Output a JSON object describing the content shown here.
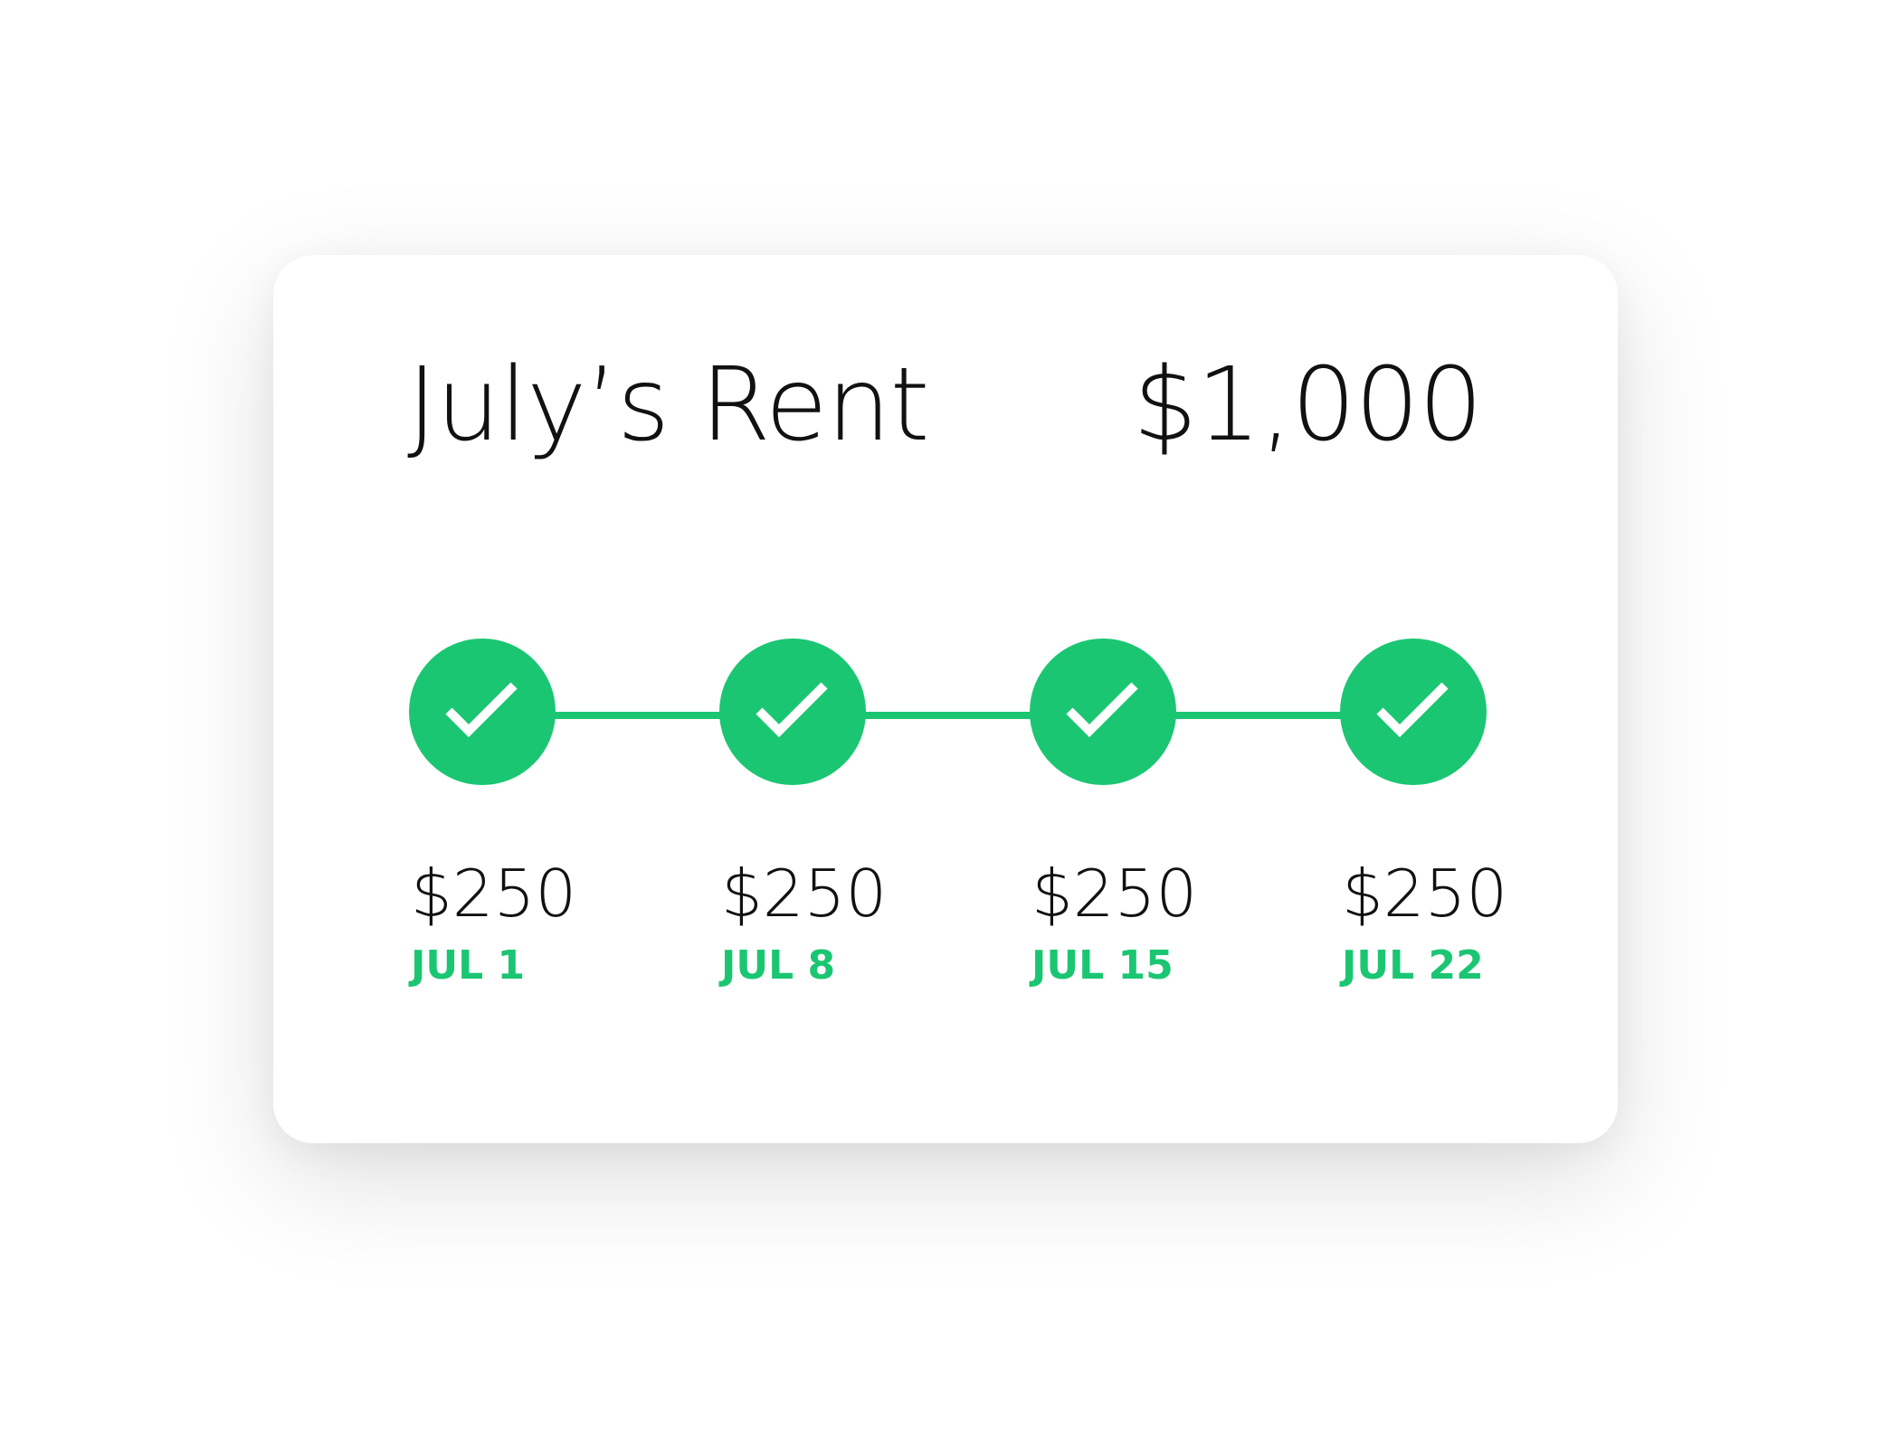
{
  "card": {
    "title": "July’s Rent",
    "total": "$1,000"
  },
  "colors": {
    "accent": "#1bc672",
    "text": "#111111",
    "card_background": "#ffffff"
  },
  "payments": [
    {
      "amount": "$250",
      "date": "JUL 1",
      "status": "paid",
      "icon": "check-icon"
    },
    {
      "amount": "$250",
      "date": "JUL 8",
      "status": "paid",
      "icon": "check-icon"
    },
    {
      "amount": "$250",
      "date": "JUL 15",
      "status": "paid",
      "icon": "check-icon"
    },
    {
      "amount": "$250",
      "date": "JUL 22",
      "status": "paid",
      "icon": "check-icon"
    }
  ]
}
